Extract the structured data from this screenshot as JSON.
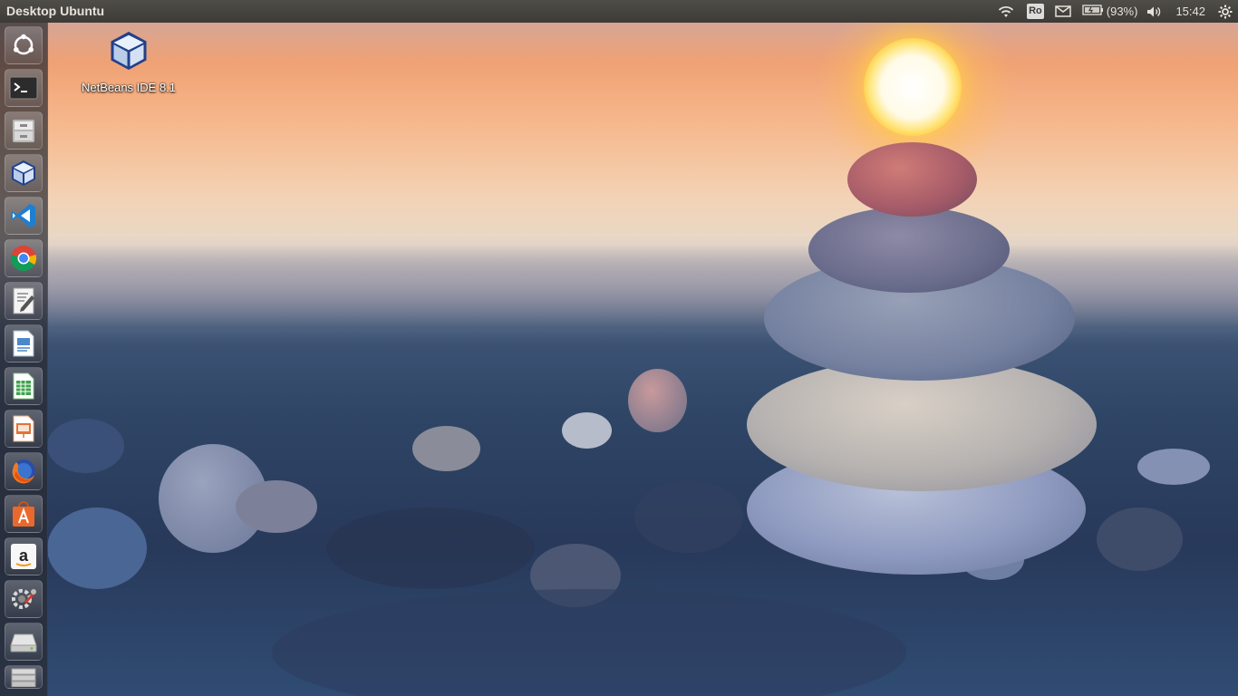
{
  "panel": {
    "title": "Desktop Ubuntu",
    "keyboard_layout": "Ro",
    "battery_text": "(93%)",
    "clock": "15:42"
  },
  "indicators": [
    "wifi-icon",
    "keyboard-layout-indicator",
    "mail-icon",
    "battery-icon",
    "volume-icon",
    "clock",
    "gear-icon"
  ],
  "launcher": {
    "items": [
      {
        "name": "ubuntu-dash-button",
        "icon": "ubuntu-logo-icon"
      },
      {
        "name": "terminal-launcher",
        "icon": "terminal-icon"
      },
      {
        "name": "files-launcher",
        "icon": "file-cabinet-icon"
      },
      {
        "name": "netbeans-launcher",
        "icon": "netbeans-cube-icon"
      },
      {
        "name": "vscode-launcher",
        "icon": "vscode-icon"
      },
      {
        "name": "chrome-launcher",
        "icon": "chrome-icon"
      },
      {
        "name": "text-editor-launcher",
        "icon": "text-editor-icon"
      },
      {
        "name": "libreoffice-writer-launcher",
        "icon": "writer-icon"
      },
      {
        "name": "libreoffice-calc-launcher",
        "icon": "calc-icon"
      },
      {
        "name": "libreoffice-impress-launcher",
        "icon": "impress-icon"
      },
      {
        "name": "firefox-launcher",
        "icon": "firefox-icon"
      },
      {
        "name": "software-center-launcher",
        "icon": "software-center-icon"
      },
      {
        "name": "amazon-launcher",
        "icon": "amazon-icon"
      },
      {
        "name": "system-settings-launcher",
        "icon": "settings-wrench-icon"
      },
      {
        "name": "drive-launcher",
        "icon": "drive-icon"
      },
      {
        "name": "workspace-switcher-launcher",
        "icon": "workspaces-icon"
      }
    ]
  },
  "desktop": {
    "icons": [
      {
        "label": "NetBeans IDE 8.1",
        "icon": "netbeans-cube-icon"
      }
    ]
  },
  "colors": {
    "panel_bg": "#3c3b37",
    "panel_text": "#e6e2da",
    "launcher_bg": "#282a32"
  }
}
